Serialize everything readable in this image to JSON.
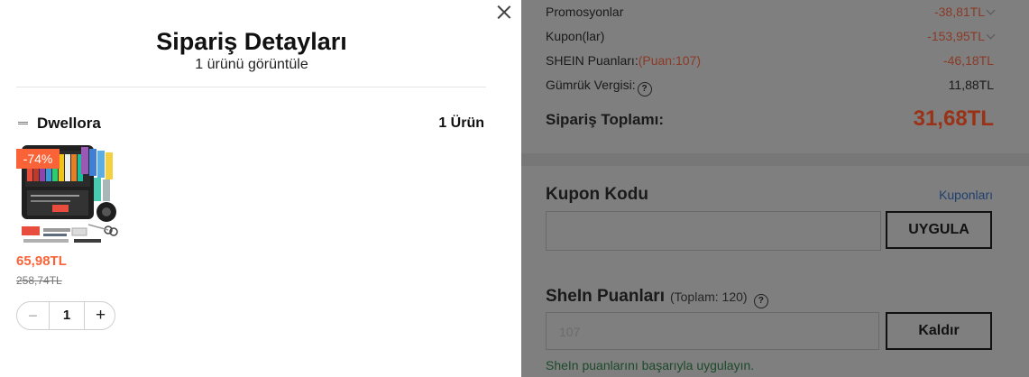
{
  "modal": {
    "title": "Sipariş Detayları",
    "subtitle": "1 ürünü görüntüle",
    "store_name": "Dwellora",
    "item_count": "1 Ürün",
    "product": {
      "discount_badge": "-74%",
      "price": "65,98TL",
      "original_price": "258,74TL",
      "quantity": "1"
    }
  },
  "summary": {
    "rows": [
      {
        "label": "Promosyonlar",
        "value": "-38,81TL"
      },
      {
        "label": "Kupon(lar)",
        "value": "-153,95TL"
      },
      {
        "label": "SHEIN Puanları:",
        "note": "(Puan:107)",
        "value": "-46,18TL"
      },
      {
        "label": "Gümrük Vergisi:",
        "value": "11,88TL"
      }
    ],
    "total_label": "Sipariş Toplamı:",
    "total_value": "31,68TL"
  },
  "coupon": {
    "title": "Kupon Kodu",
    "link": "Kuponları",
    "apply_label": "UYGULA",
    "value": ""
  },
  "points": {
    "title": "SheIn Puanları",
    "total": "(Toplam: 120)",
    "input_value": "107",
    "remove_label": "Kaldır",
    "success": "SheIn puanlarını başarıyla uygulayın."
  },
  "colors": {
    "accent": "#fa6338",
    "overlay": "#7f7f7f"
  }
}
